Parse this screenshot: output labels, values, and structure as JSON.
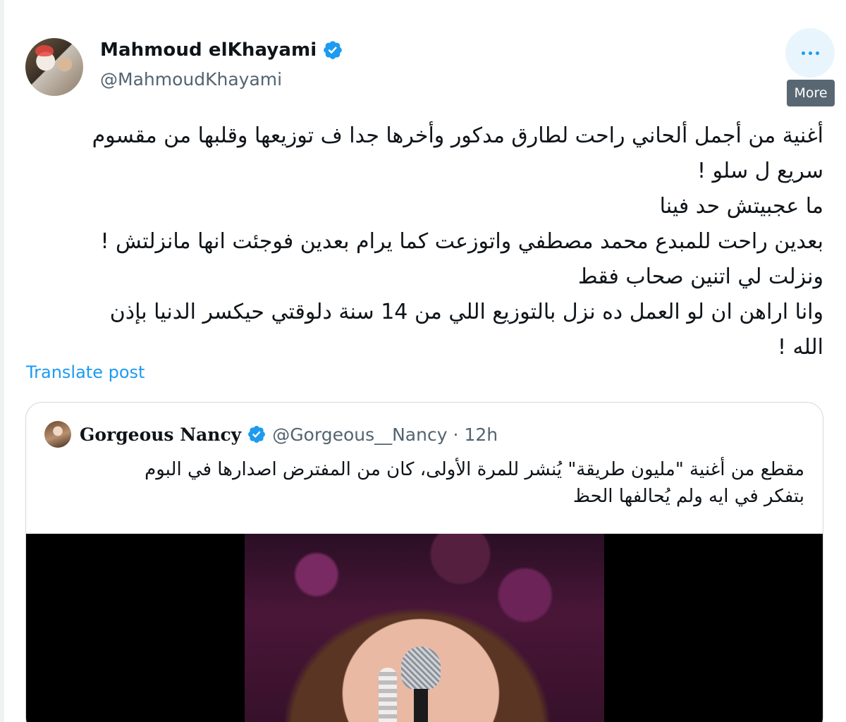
{
  "author": {
    "name": "Mahmoud elKhayami",
    "handle": "@MahmoudKhayami",
    "verified": true
  },
  "more_button": {
    "icon": "more-dots-icon",
    "tooltip": "More"
  },
  "tweet": {
    "lines": [
      "أغنية من أجمل ألحاني راحت لطارق مدكور وأخرها جدا ف توزيعها وقلبها من مقسوم",
      "سريع ل سلو !",
      "ما عجبيتش حد فينا",
      "بعدين راحت للمبدع محمد مصطفي واتوزعت كما يرام بعدين فوجئت انها مانزلتش !",
      "ونزلت لي اتنين صحاب فقط",
      "وانا اراهن ان لو العمل ده نزل بالتوزيع اللي من 14 سنة  دلوقتي حيكسر الدنيا بإذن",
      "الله !"
    ],
    "translate_label": "Translate post"
  },
  "quoted_tweet": {
    "name": "Gorgeous Nancy",
    "handle": "@Gorgeous__Nancy",
    "separator": "·",
    "time": "12h",
    "verified": true,
    "lines": [
      "مقطع من أغنية \"مليون طريقة\" يُنشر للمرة الأولى، كان من المفترض اصدارها في البوم",
      "بتفكر في ايه ولم يُحالفها الحظ"
    ]
  },
  "colors": {
    "accent": "#1d9bf0",
    "text": "#0f1419",
    "secondary_text": "#536471",
    "border": "#cfd9de",
    "tooltip_bg": "#596773"
  }
}
